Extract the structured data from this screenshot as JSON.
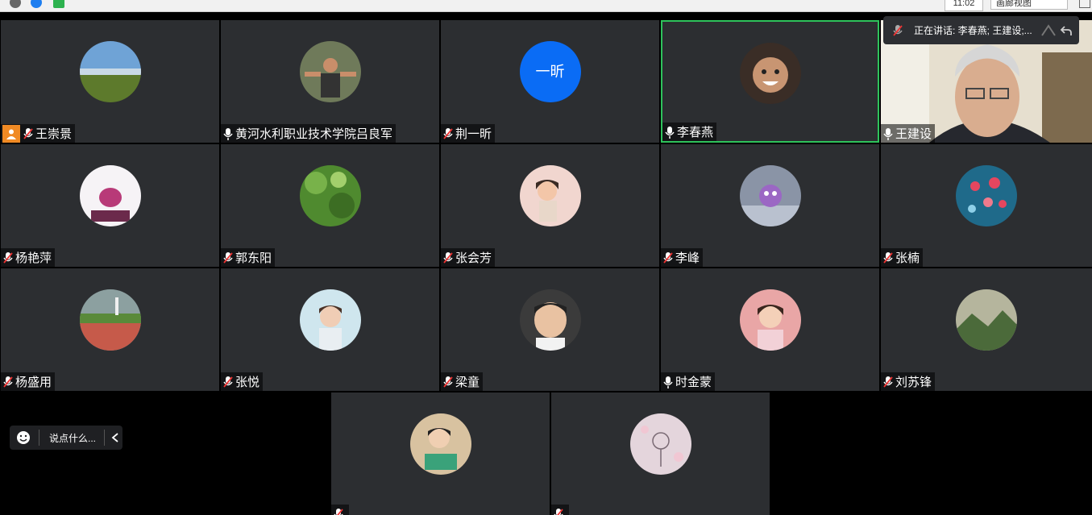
{
  "topbar": {
    "time": "11:02",
    "view_label": "画廊视图"
  },
  "speaking": {
    "text": "正在讲话: 李春燕; 王建设;..."
  },
  "chat": {
    "placeholder": "说点什么..."
  },
  "participants": [
    {
      "name": "王崇景",
      "avatar": "lake-photo",
      "mic": "muted",
      "host": true
    },
    {
      "name": "黄河水利职业技术学院吕良军",
      "avatar": "person-photo",
      "mic": "on"
    },
    {
      "name": "荆一昕",
      "avatar_text": "一昕",
      "mic": "muted"
    },
    {
      "name": "李春燕",
      "avatar": "child-photo",
      "mic": "on",
      "active": true
    },
    {
      "name": "王建设",
      "avatar": "video-feed",
      "mic": "on"
    },
    {
      "name": "杨艳萍",
      "avatar": "drawing-photo",
      "mic": "muted"
    },
    {
      "name": "郭东阳",
      "avatar": "tree-photo",
      "mic": "muted"
    },
    {
      "name": "张会芳",
      "avatar": "illustration-photo",
      "mic": "muted"
    },
    {
      "name": "李峰",
      "avatar": "cartoon-photo",
      "mic": "muted"
    },
    {
      "name": "张楠",
      "avatar": "flower-photo",
      "mic": "muted"
    },
    {
      "name": "杨盛用",
      "avatar": "landscape-photo",
      "mic": "muted"
    },
    {
      "name": "张悦",
      "avatar": "woman-photo",
      "mic": "muted"
    },
    {
      "name": "梁童",
      "avatar": "boy-photo",
      "mic": "muted"
    },
    {
      "name": "时金蒙",
      "avatar": "girl-photo",
      "mic": "on"
    },
    {
      "name": "刘苏锋",
      "avatar": "mountain-photo",
      "mic": "muted"
    },
    {
      "name": "",
      "avatar": "child-reading-photo",
      "mic": "muted"
    },
    {
      "name": "",
      "avatar": "blossom-photo",
      "mic": "muted"
    }
  ],
  "colors": {
    "tile_bg": "#2c2e31",
    "active_border": "#2ec25b",
    "host_badge": "#f08a24",
    "text_avatar_bg": "#0a6cf5"
  }
}
